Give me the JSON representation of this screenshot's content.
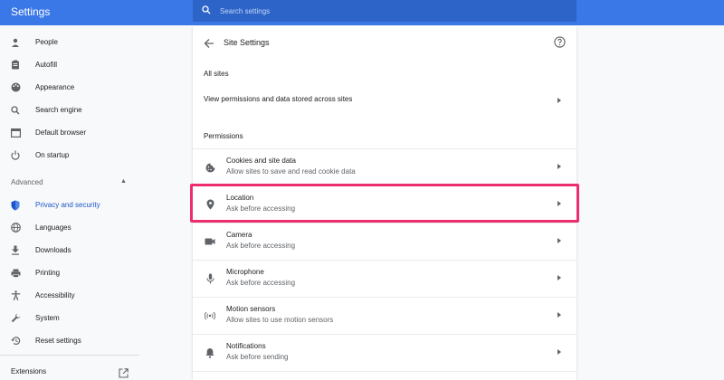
{
  "app": {
    "title": "Settings"
  },
  "search": {
    "placeholder": "Search settings"
  },
  "sidebar": {
    "items": [
      {
        "label": "People",
        "icon": "person-icon"
      },
      {
        "label": "Autofill",
        "icon": "clipboard-icon"
      },
      {
        "label": "Appearance",
        "icon": "palette-icon"
      },
      {
        "label": "Search engine",
        "icon": "search-icon"
      },
      {
        "label": "Default browser",
        "icon": "browser-icon"
      },
      {
        "label": "On startup",
        "icon": "power-icon"
      }
    ],
    "advanced_label": "Advanced",
    "advanced_items": [
      {
        "label": "Privacy and security",
        "icon": "shield-icon",
        "active": true
      },
      {
        "label": "Languages",
        "icon": "globe-icon"
      },
      {
        "label": "Downloads",
        "icon": "download-icon"
      },
      {
        "label": "Printing",
        "icon": "printer-icon"
      },
      {
        "label": "Accessibility",
        "icon": "accessibility-icon"
      },
      {
        "label": "System",
        "icon": "wrench-icon"
      },
      {
        "label": "Reset settings",
        "icon": "history-icon"
      }
    ],
    "extensions_label": "Extensions"
  },
  "main": {
    "title": "Site Settings",
    "all_sites_label": "All sites",
    "view_permissions_label": "View permissions and data stored across sites",
    "permissions_label": "Permissions",
    "permissions": [
      {
        "title": "Cookies and site data",
        "subtitle": "Allow sites to save and read cookie data",
        "icon": "cookie-icon"
      },
      {
        "title": "Location",
        "subtitle": "Ask before accessing",
        "icon": "location-pin-icon"
      },
      {
        "title": "Camera",
        "subtitle": "Ask before accessing",
        "icon": "camera-icon"
      },
      {
        "title": "Microphone",
        "subtitle": "Ask before accessing",
        "icon": "microphone-icon"
      },
      {
        "title": "Motion sensors",
        "subtitle": "Allow sites to use motion sensors",
        "icon": "motion-sensor-icon"
      },
      {
        "title": "Notifications",
        "subtitle": "Ask before sending",
        "icon": "bell-icon"
      }
    ]
  },
  "colors": {
    "header": "#3b78e7",
    "search_bg": "#2c64c8",
    "accent": "#1a56c9",
    "highlight": "#ec2e6e"
  }
}
